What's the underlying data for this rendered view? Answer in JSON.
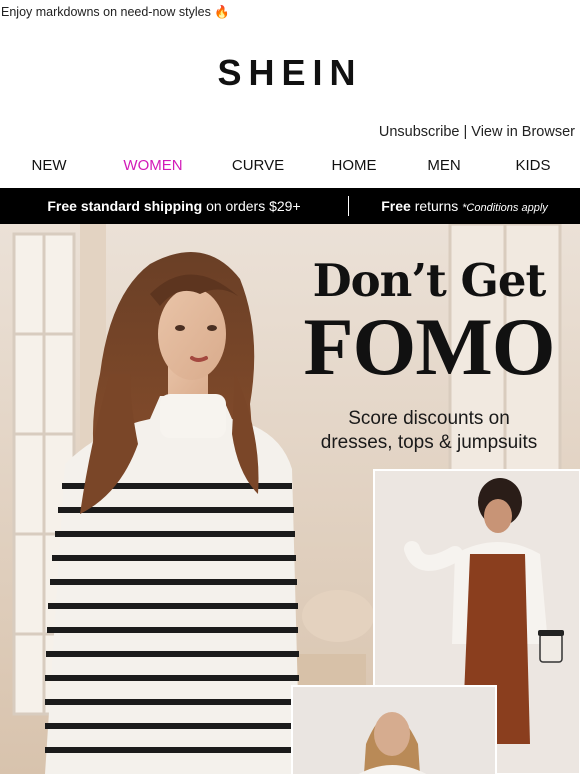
{
  "preheader": {
    "text": "Enjoy markdowns on need-now styles 🔥"
  },
  "brand": {
    "logo_text": "SHEIN"
  },
  "util_links": {
    "unsubscribe": "Unsubscribe",
    "separator": "|",
    "view_in_browser": "View in Browser"
  },
  "nav": {
    "items": [
      {
        "label": "NEW"
      },
      {
        "label": "WOMEN",
        "active": true
      },
      {
        "label": "CURVE"
      },
      {
        "label": "HOME"
      },
      {
        "label": "MEN"
      },
      {
        "label": "KIDS"
      }
    ],
    "active_color": "#d21bb8"
  },
  "shipping_bar": {
    "left_bold": "Free standard shipping",
    "left_rest": "on orders $29+",
    "right_bold": "Free",
    "right_rest": "returns",
    "right_note": "*Conditions apply"
  },
  "hero": {
    "title_line1": "Don’t Get",
    "title_line2": "FOMO",
    "subtitle_line1": "Score discounts on",
    "subtitle_line2": "dresses, tops & jumpsuits"
  },
  "colors": {
    "bar_bg": "#000000",
    "accent": "#d21bb8"
  }
}
